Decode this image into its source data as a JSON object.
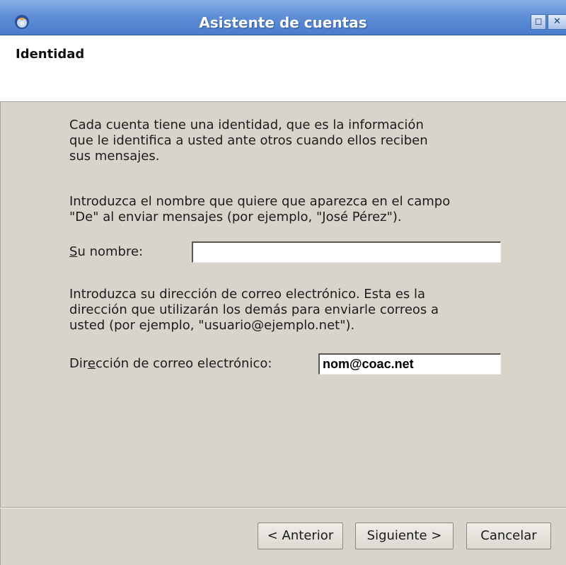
{
  "window": {
    "title": "Asistente de cuentas",
    "controls": [
      "maximize",
      "close"
    ],
    "icon": "thunderbird-app-icon"
  },
  "page": {
    "heading": "Identidad"
  },
  "intro": {
    "line1": "Cada cuenta tiene una identidad, que es la información",
    "line2": "que le identifica a usted ante otros cuando ellos reciben",
    "line3": "sus mensajes."
  },
  "name_help": {
    "line1": "Introduzca el nombre que quiere que aparezca en el campo",
    "line2": "\"De\" al enviar mensajes (por ejemplo, \"José Pérez\")."
  },
  "name_field": {
    "label_accel": "S",
    "label_rest": "u nombre:",
    "value": ""
  },
  "email_help": {
    "line1": "Introduzca su dirección de correo electrónico. Esta es la",
    "line2": "dirección que utilizarán los demás para enviarle correos a",
    "line3": "usted (por ejemplo, \"usuario@ejemplo.net\")."
  },
  "email_field": {
    "label_pre": "Dir",
    "label_accel": "e",
    "label_post": "cción de correo electrónico:",
    "value": "nom@coac.net"
  },
  "buttons": {
    "back": "< Anterior",
    "next": "Siguiente >",
    "cancel": "Cancelar"
  },
  "colors": {
    "titlebar": "#5f8fd6",
    "dialog_bg": "#d8d4cc",
    "header_bg": "#ffffff"
  }
}
